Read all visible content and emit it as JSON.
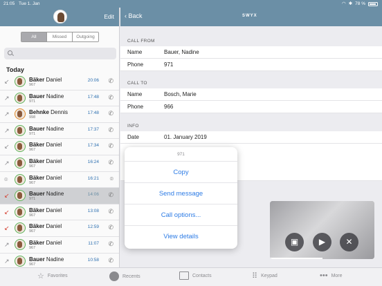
{
  "status": {
    "time": "21:05",
    "date": "Tue 1. Jan",
    "battery": "78 %"
  },
  "left": {
    "edit_label": "Edit",
    "segments": [
      "All",
      "Missed",
      "Outgoing"
    ],
    "active_segment": "All",
    "section_title": "Today",
    "calls": [
      {
        "first": "Bäker",
        "last": "Daniel",
        "number": "967",
        "time": "20:06",
        "dir": "in",
        "color": "green"
      },
      {
        "first": "Bauer",
        "last": "Nadine",
        "number": "971",
        "time": "17:48",
        "dir": "out",
        "color": "green"
      },
      {
        "first": "Behnke",
        "last": "Dennis",
        "number": "998",
        "time": "17:48",
        "dir": "out",
        "color": "orange"
      },
      {
        "first": "Bauer",
        "last": "Nadine",
        "number": "971",
        "time": "17:37",
        "dir": "out",
        "color": "green"
      },
      {
        "first": "Bäker",
        "last": "Daniel",
        "number": "967",
        "time": "17:34",
        "dir": "in",
        "color": "green"
      },
      {
        "first": "Bäker",
        "last": "Daniel",
        "number": "967",
        "time": "16:24",
        "dir": "out",
        "color": "green"
      },
      {
        "first": "Bäker",
        "last": "Daniel",
        "number": "967",
        "time": "16:21",
        "dir": "voicemail",
        "color": "green"
      },
      {
        "first": "Bauer",
        "last": "Nadine",
        "number": "971",
        "time": "14:06",
        "dir": "missed",
        "color": "green",
        "selected": true
      },
      {
        "first": "Bäker",
        "last": "Daniel",
        "number": "967",
        "time": "13:08",
        "dir": "missed",
        "color": "green"
      },
      {
        "first": "Bäker",
        "last": "Daniel",
        "number": "967",
        "time": "12:59",
        "dir": "missed",
        "color": "green"
      },
      {
        "first": "Bäker",
        "last": "Daniel",
        "number": "967",
        "time": "11:07",
        "dir": "out",
        "color": "green"
      },
      {
        "first": "Bauer",
        "last": "Nadine",
        "number": "967",
        "time": "10:58",
        "dir": "out",
        "color": "green"
      }
    ]
  },
  "right": {
    "back_label": "Back",
    "logo": "SWYX",
    "call_from": {
      "label": "CALL FROM",
      "name_key": "Name",
      "name": "Bauer, Nadine",
      "phone_key": "Phone",
      "phone": "971"
    },
    "call_to": {
      "label": "CALL TO",
      "name_key": "Name",
      "name": "Bosch, Marie",
      "phone_key": "Phone",
      "phone": "966"
    },
    "info": {
      "label": "INFO",
      "date_key": "Date",
      "date": "01. January 2019"
    }
  },
  "popover": {
    "title": "971",
    "items": [
      "Copy",
      "Send message",
      "Call options...",
      "View details"
    ]
  },
  "video": {
    "progress_fraction": 0.5
  },
  "tabs": [
    "Favorites",
    "Recents",
    "Contacts",
    "Keypad",
    "More"
  ],
  "colors": {
    "header": "#6b8fa6",
    "accent": "#2c7be5",
    "missed": "#d23a2a"
  }
}
